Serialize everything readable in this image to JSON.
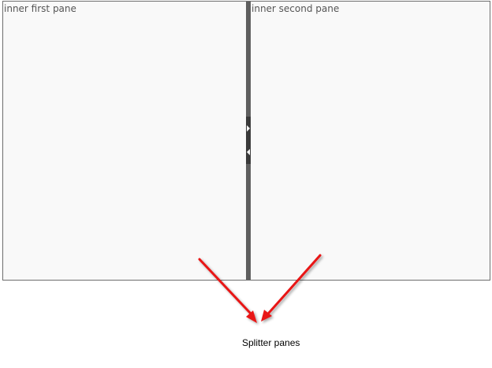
{
  "panes": {
    "first": {
      "label": "inner first pane"
    },
    "second": {
      "label": "inner second pane"
    }
  },
  "splitbar": {
    "collapse_right_icon": "triangle-right-icon",
    "collapse_left_icon": "triangle-left-icon"
  },
  "annotation": {
    "label": "Splitter panes",
    "arrow_color": "#e81414"
  },
  "colors": {
    "pane_background": "#f9f9f9",
    "splitbar": "#5f5f5f",
    "border": "#6e6e6e"
  }
}
